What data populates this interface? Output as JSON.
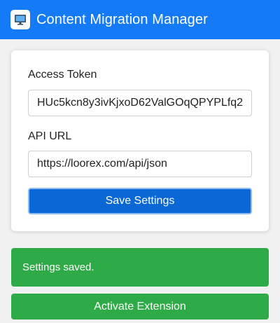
{
  "header": {
    "title": "Content Migration Manager",
    "logo_icon": "monitor-icon",
    "background": "#157af6"
  },
  "settings": {
    "token_label": "Access Token",
    "token_value": "HUc5kcn8y3ivKjxoD62ValGOqQPYPLfq2",
    "api_url_label": "API URL",
    "api_url_value": "https://loorex.com/api/json",
    "save_label": "Save Settings"
  },
  "status": {
    "message": "Settings saved.",
    "color": "#2eab46"
  },
  "actions": {
    "activate_label": "Activate Extension"
  }
}
